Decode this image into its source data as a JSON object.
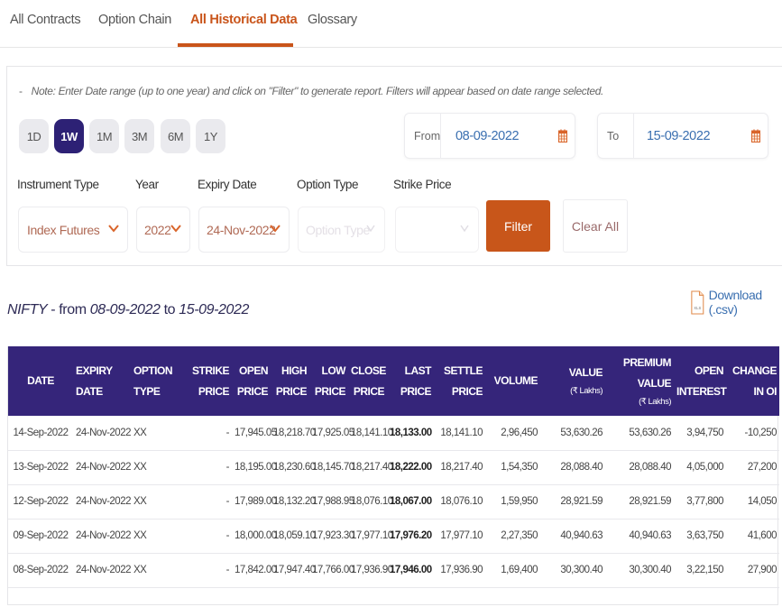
{
  "tabs": [
    {
      "label": "All Contracts",
      "active": false
    },
    {
      "label": "Option Chain",
      "active": false
    },
    {
      "label": "All Historical Data",
      "active": true
    },
    {
      "label": "Glossary",
      "active": false
    }
  ],
  "filters": {
    "note": "Note: Enter Date range (up to one year) and click on \"Filter\" to generate report. Filters will appear based on date range selected.",
    "note_bullet": "-",
    "periods": [
      {
        "label": "1D",
        "active": false
      },
      {
        "label": "1W",
        "active": true
      },
      {
        "label": "1M",
        "active": false
      },
      {
        "label": "3M",
        "active": false
      },
      {
        "label": "6M",
        "active": false
      },
      {
        "label": "1Y",
        "active": false
      }
    ],
    "from": {
      "label": "From",
      "value": "08-09-2022",
      "icon": "calendar-icon"
    },
    "to": {
      "label": "To",
      "value": "15-09-2022",
      "icon": "calendar-icon"
    },
    "instrument_type": {
      "label": "Instrument Type",
      "value": "Index Futures"
    },
    "year": {
      "label": "Year",
      "value": "2022"
    },
    "expiry_date": {
      "label": "Expiry Date",
      "value": "24-Nov-2022"
    },
    "option_type": {
      "label": "Option Type",
      "placeholder": "Option Type",
      "disabled": true
    },
    "strike_price": {
      "label": "Strike Price",
      "value": "",
      "disabled": true
    },
    "filter_label": "Filter",
    "clear_label": "Clear All"
  },
  "results": {
    "symbol": "NIFTY",
    "from_text": " - from ",
    "from_date": "08-09-2022",
    "to_text": " to ",
    "to_date": "15-09-2022",
    "download_label": "Download (.csv)",
    "download_icon": "xls-file-icon"
  },
  "table": {
    "headers": [
      {
        "line1": "DATE",
        "line2": "",
        "sub": ""
      },
      {
        "line1": "EXPIRY DATE",
        "line2": "",
        "sub": ""
      },
      {
        "line1": "OPTION",
        "line2": "TYPE",
        "sub": ""
      },
      {
        "line1": "STRIKE",
        "line2": "PRICE",
        "sub": ""
      },
      {
        "line1": "OPEN",
        "line2": "PRICE",
        "sub": ""
      },
      {
        "line1": "HIGH",
        "line2": "PRICE",
        "sub": ""
      },
      {
        "line1": "LOW",
        "line2": "PRICE",
        "sub": ""
      },
      {
        "line1": "CLOSE",
        "line2": "PRICE",
        "sub": ""
      },
      {
        "line1": "LAST",
        "line2": "PRICE",
        "sub": ""
      },
      {
        "line1": "SETTLE",
        "line2": "PRICE",
        "sub": ""
      },
      {
        "line1": "VOLUME",
        "line2": "",
        "sub": ""
      },
      {
        "line1": "VALUE",
        "line2": "",
        "sub": "(₹ Lakhs)"
      },
      {
        "line1": "PREMIUM",
        "line2": "VALUE",
        "sub": "(₹ Lakhs)"
      },
      {
        "line1": "OPEN",
        "line2": "INTEREST",
        "sub": ""
      },
      {
        "line1": "CHANGE IN OI",
        "line2": "",
        "sub": ""
      }
    ],
    "rows": [
      [
        "14-Sep-2022",
        "24-Nov-2022",
        "XX",
        "-",
        "17,945.05",
        "18,218.70",
        "17,925.05",
        "18,141.10",
        "18,133.00",
        "18,141.10",
        "2,96,450",
        "53,630.26",
        "53,630.26",
        "3,94,750",
        "-10,250"
      ],
      [
        "13-Sep-2022",
        "24-Nov-2022",
        "XX",
        "-",
        "18,195.00",
        "18,230.60",
        "18,145.70",
        "18,217.40",
        "18,222.00",
        "18,217.40",
        "1,54,350",
        "28,088.40",
        "28,088.40",
        "4,05,000",
        "27,200"
      ],
      [
        "12-Sep-2022",
        "24-Nov-2022",
        "XX",
        "-",
        "17,989.00",
        "18,132.20",
        "17,988.95",
        "18,076.10",
        "18,067.00",
        "18,076.10",
        "1,59,950",
        "28,921.59",
        "28,921.59",
        "3,77,800",
        "14,050"
      ],
      [
        "09-Sep-2022",
        "24-Nov-2022",
        "XX",
        "-",
        "18,000.00",
        "18,059.10",
        "17,923.30",
        "17,977.10",
        "17,976.20",
        "17,977.10",
        "2,27,350",
        "40,940.63",
        "40,940.63",
        "3,63,750",
        "41,600"
      ],
      [
        "08-Sep-2022",
        "24-Nov-2022",
        "XX",
        "-",
        "17,842.00",
        "17,947.40",
        "17,766.00",
        "17,936.90",
        "17,946.00",
        "17,936.90",
        "1,69,400",
        "30,300.40",
        "30,300.40",
        "3,22,150",
        "27,900"
      ]
    ]
  },
  "colors": {
    "accent": "#c9541a",
    "header_bg": "#35257a",
    "active_period": "#2d2175",
    "link": "#3a6fb0"
  }
}
